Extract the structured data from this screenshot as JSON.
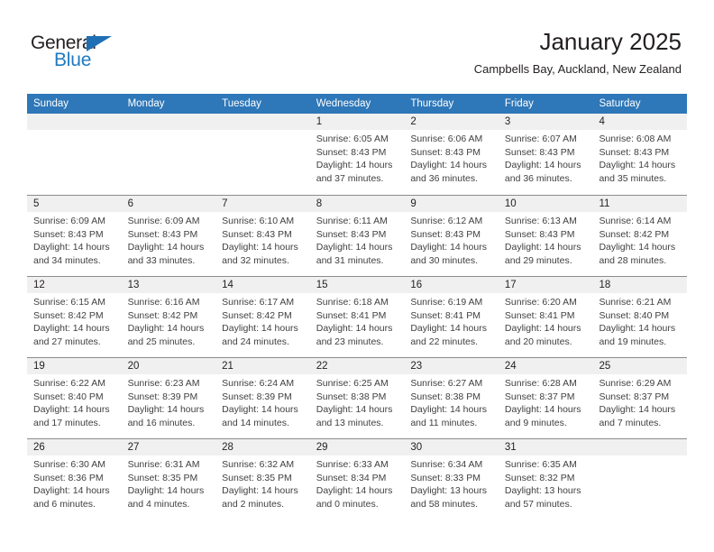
{
  "brand": {
    "name_part1": "General",
    "name_part2": "Blue",
    "triangle_icon": "blue-triangle-icon",
    "accent_color": "#1f7ac0"
  },
  "header": {
    "title": "January 2025",
    "location": "Campbells Bay, Auckland, New Zealand"
  },
  "colors": {
    "header_row_bg": "#2e77b8",
    "day_band_bg": "#f0f0f0",
    "row_divider": "#8c8c8c",
    "text": "#231f20",
    "body_text": "#404040"
  },
  "calendar": {
    "day_headers": [
      "Sunday",
      "Monday",
      "Tuesday",
      "Wednesday",
      "Thursday",
      "Friday",
      "Saturday"
    ],
    "weeks": [
      [
        {
          "day": "",
          "lines": []
        },
        {
          "day": "",
          "lines": []
        },
        {
          "day": "",
          "lines": []
        },
        {
          "day": "1",
          "lines": [
            "Sunrise: 6:05 AM",
            "Sunset: 8:43 PM",
            "Daylight: 14 hours",
            "and 37 minutes."
          ]
        },
        {
          "day": "2",
          "lines": [
            "Sunrise: 6:06 AM",
            "Sunset: 8:43 PM",
            "Daylight: 14 hours",
            "and 36 minutes."
          ]
        },
        {
          "day": "3",
          "lines": [
            "Sunrise: 6:07 AM",
            "Sunset: 8:43 PM",
            "Daylight: 14 hours",
            "and 36 minutes."
          ]
        },
        {
          "day": "4",
          "lines": [
            "Sunrise: 6:08 AM",
            "Sunset: 8:43 PM",
            "Daylight: 14 hours",
            "and 35 minutes."
          ]
        }
      ],
      [
        {
          "day": "5",
          "lines": [
            "Sunrise: 6:09 AM",
            "Sunset: 8:43 PM",
            "Daylight: 14 hours",
            "and 34 minutes."
          ]
        },
        {
          "day": "6",
          "lines": [
            "Sunrise: 6:09 AM",
            "Sunset: 8:43 PM",
            "Daylight: 14 hours",
            "and 33 minutes."
          ]
        },
        {
          "day": "7",
          "lines": [
            "Sunrise: 6:10 AM",
            "Sunset: 8:43 PM",
            "Daylight: 14 hours",
            "and 32 minutes."
          ]
        },
        {
          "day": "8",
          "lines": [
            "Sunrise: 6:11 AM",
            "Sunset: 8:43 PM",
            "Daylight: 14 hours",
            "and 31 minutes."
          ]
        },
        {
          "day": "9",
          "lines": [
            "Sunrise: 6:12 AM",
            "Sunset: 8:43 PM",
            "Daylight: 14 hours",
            "and 30 minutes."
          ]
        },
        {
          "day": "10",
          "lines": [
            "Sunrise: 6:13 AM",
            "Sunset: 8:43 PM",
            "Daylight: 14 hours",
            "and 29 minutes."
          ]
        },
        {
          "day": "11",
          "lines": [
            "Sunrise: 6:14 AM",
            "Sunset: 8:42 PM",
            "Daylight: 14 hours",
            "and 28 minutes."
          ]
        }
      ],
      [
        {
          "day": "12",
          "lines": [
            "Sunrise: 6:15 AM",
            "Sunset: 8:42 PM",
            "Daylight: 14 hours",
            "and 27 minutes."
          ]
        },
        {
          "day": "13",
          "lines": [
            "Sunrise: 6:16 AM",
            "Sunset: 8:42 PM",
            "Daylight: 14 hours",
            "and 25 minutes."
          ]
        },
        {
          "day": "14",
          "lines": [
            "Sunrise: 6:17 AM",
            "Sunset: 8:42 PM",
            "Daylight: 14 hours",
            "and 24 minutes."
          ]
        },
        {
          "day": "15",
          "lines": [
            "Sunrise: 6:18 AM",
            "Sunset: 8:41 PM",
            "Daylight: 14 hours",
            "and 23 minutes."
          ]
        },
        {
          "day": "16",
          "lines": [
            "Sunrise: 6:19 AM",
            "Sunset: 8:41 PM",
            "Daylight: 14 hours",
            "and 22 minutes."
          ]
        },
        {
          "day": "17",
          "lines": [
            "Sunrise: 6:20 AM",
            "Sunset: 8:41 PM",
            "Daylight: 14 hours",
            "and 20 minutes."
          ]
        },
        {
          "day": "18",
          "lines": [
            "Sunrise: 6:21 AM",
            "Sunset: 8:40 PM",
            "Daylight: 14 hours",
            "and 19 minutes."
          ]
        }
      ],
      [
        {
          "day": "19",
          "lines": [
            "Sunrise: 6:22 AM",
            "Sunset: 8:40 PM",
            "Daylight: 14 hours",
            "and 17 minutes."
          ]
        },
        {
          "day": "20",
          "lines": [
            "Sunrise: 6:23 AM",
            "Sunset: 8:39 PM",
            "Daylight: 14 hours",
            "and 16 minutes."
          ]
        },
        {
          "day": "21",
          "lines": [
            "Sunrise: 6:24 AM",
            "Sunset: 8:39 PM",
            "Daylight: 14 hours",
            "and 14 minutes."
          ]
        },
        {
          "day": "22",
          "lines": [
            "Sunrise: 6:25 AM",
            "Sunset: 8:38 PM",
            "Daylight: 14 hours",
            "and 13 minutes."
          ]
        },
        {
          "day": "23",
          "lines": [
            "Sunrise: 6:27 AM",
            "Sunset: 8:38 PM",
            "Daylight: 14 hours",
            "and 11 minutes."
          ]
        },
        {
          "day": "24",
          "lines": [
            "Sunrise: 6:28 AM",
            "Sunset: 8:37 PM",
            "Daylight: 14 hours",
            "and 9 minutes."
          ]
        },
        {
          "day": "25",
          "lines": [
            "Sunrise: 6:29 AM",
            "Sunset: 8:37 PM",
            "Daylight: 14 hours",
            "and 7 minutes."
          ]
        }
      ],
      [
        {
          "day": "26",
          "lines": [
            "Sunrise: 6:30 AM",
            "Sunset: 8:36 PM",
            "Daylight: 14 hours",
            "and 6 minutes."
          ]
        },
        {
          "day": "27",
          "lines": [
            "Sunrise: 6:31 AM",
            "Sunset: 8:35 PM",
            "Daylight: 14 hours",
            "and 4 minutes."
          ]
        },
        {
          "day": "28",
          "lines": [
            "Sunrise: 6:32 AM",
            "Sunset: 8:35 PM",
            "Daylight: 14 hours",
            "and 2 minutes."
          ]
        },
        {
          "day": "29",
          "lines": [
            "Sunrise: 6:33 AM",
            "Sunset: 8:34 PM",
            "Daylight: 14 hours",
            "and 0 minutes."
          ]
        },
        {
          "day": "30",
          "lines": [
            "Sunrise: 6:34 AM",
            "Sunset: 8:33 PM",
            "Daylight: 13 hours",
            "and 58 minutes."
          ]
        },
        {
          "day": "31",
          "lines": [
            "Sunrise: 6:35 AM",
            "Sunset: 8:32 PM",
            "Daylight: 13 hours",
            "and 57 minutes."
          ]
        },
        {
          "day": "",
          "lines": []
        }
      ]
    ]
  }
}
